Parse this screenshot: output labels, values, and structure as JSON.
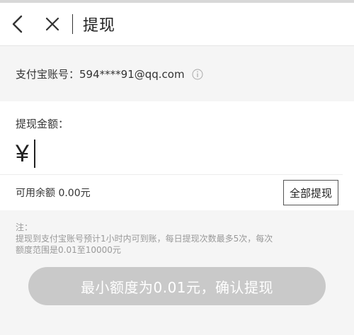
{
  "header": {
    "back_icon": "chevron-left-icon",
    "close_icon": "close-icon",
    "title": "提现"
  },
  "account": {
    "label": "支付宝账号：",
    "value": "594****91@qq.com",
    "info_icon": "info-icon"
  },
  "amount": {
    "label": "提现金额：",
    "currency_symbol": "¥",
    "value": ""
  },
  "balance": {
    "text": "可用余额 0.00元",
    "withdraw_all_label": "全部提现"
  },
  "notes": {
    "title": "注：",
    "line1": "提现到支付宝账号预计1小时内可到账，每日提现次数最多5次，每次",
    "line2": "额度范围是0.01至10000元"
  },
  "confirm": {
    "label": "最小额度为0.01元，确认提现",
    "enabled": false
  },
  "colors": {
    "background": "#f5f5f5",
    "card": "#ffffff",
    "button_disabled": "#c9c9c9",
    "note_text": "#999999"
  }
}
